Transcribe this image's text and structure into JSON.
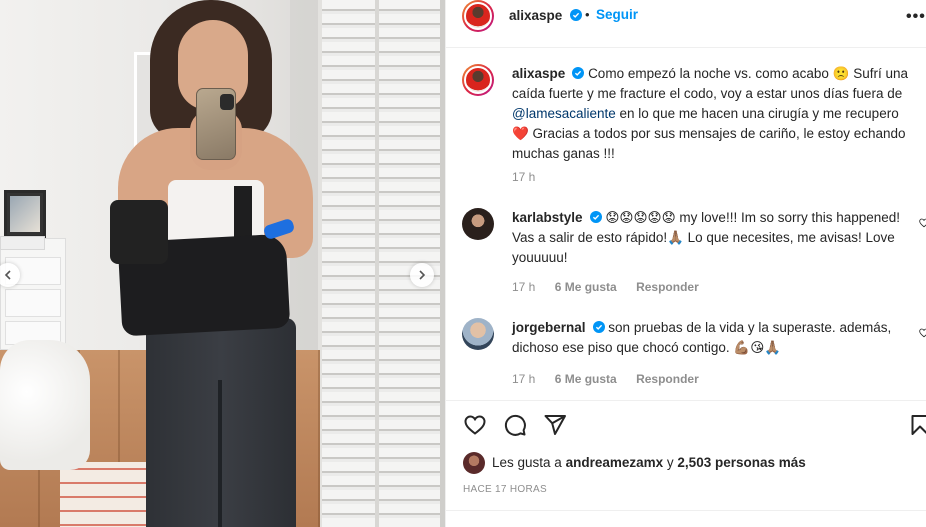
{
  "post": {
    "author": "alixaspe",
    "follow_label": "Seguir",
    "dot": "•",
    "more_label": "•••",
    "caption_text": "Como empezó la noche vs. como acabo 🙁 Sufrí una caída fuerte y me fracture el codo, voy a estar unos días fuera de",
    "caption_mention": "@lamesacaliente",
    "caption_text2": "en lo que me hacen una cirugía y me recupero ❤️ Gracias a todos por sus mensajes de cariño, le estoy echando muchas ganas !!!",
    "caption_time": "17 h"
  },
  "comments": [
    {
      "user": "karlabstyle",
      "text": "😟😟😟😟😟 my love!!! Im so sorry this happened! Vas a salir de esto rápido!🙏🏽 Lo que necesites, me avisas! Love youuuuu!",
      "time": "17 h",
      "likes": "6 Me gusta",
      "reply": "Responder"
    },
    {
      "user": "jorgebernal",
      "text": "son pruebas de la vida y la superaste. además, dichoso ese piso que chocó contigo. 💪🏽😘🙏🏽",
      "time": "17 h",
      "likes": "6 Me gusta",
      "reply": "Responder"
    }
  ],
  "likes_summary": {
    "prefix": "Les gusta a",
    "user": "andreamezamx",
    "middle": "y",
    "count": "2,503 personas más"
  },
  "time_ago": "HACE 17 HORAS",
  "colors": {
    "accent": "#0095f6",
    "verified": "#0095f6",
    "heart": "#ed4956",
    "muted": "#8e8e8e"
  },
  "icons": {
    "like": "heart-icon",
    "comment": "comment-icon",
    "share": "send-icon",
    "save": "bookmark-icon",
    "carousel_prev": "chevron-left-icon",
    "carousel_next": "chevron-right-icon"
  }
}
